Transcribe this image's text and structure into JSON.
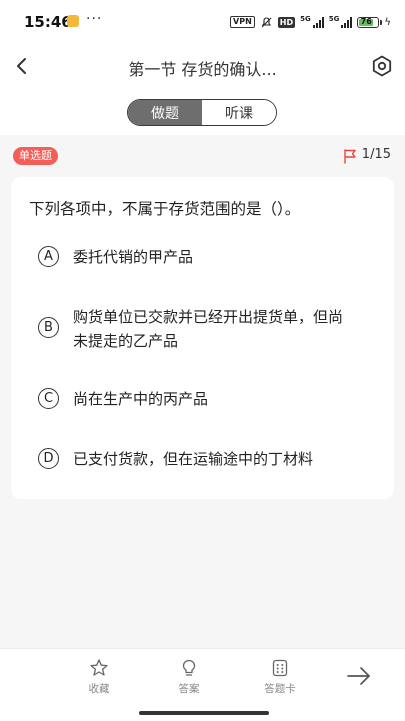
{
  "status_bar": {
    "time": "15:46",
    "more": "···",
    "vpn": "VPN",
    "hd": "HD",
    "signal1": "5G",
    "signal2": "5G",
    "battery": "76"
  },
  "header": {
    "title": "第一节 存货的确认..."
  },
  "tabs": [
    {
      "label": "做题",
      "active": true
    },
    {
      "label": "听课",
      "active": false
    }
  ],
  "question": {
    "type_badge": "单选题",
    "progress": "1/15",
    "stem": "下列各项中，不属于存货范围的是（）。",
    "options": [
      {
        "letter": "A",
        "text": "委托代销的甲产品"
      },
      {
        "letter": "B",
        "text": "购货单位已交款并已经开出提货单，但尚未提走的乙产品"
      },
      {
        "letter": "C",
        "text": "尚在生产中的丙产品"
      },
      {
        "letter": "D",
        "text": "已支付货款，但在运输途中的丁材料"
      }
    ]
  },
  "bottom_bar": {
    "favorite": "收藏",
    "answer": "答案",
    "answer_card": "答题卡"
  },
  "colors": {
    "badge": "#f45e58",
    "flag": "#e9453f",
    "battery": "#5fc25a"
  }
}
